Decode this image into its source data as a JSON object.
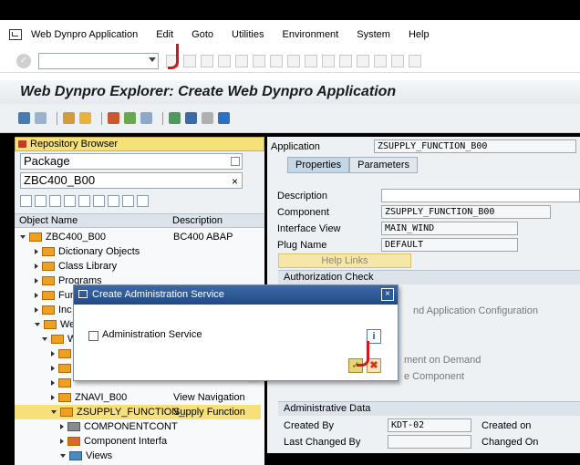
{
  "menubar": {
    "items": [
      {
        "label": "Web Dynpro Application"
      },
      {
        "label": "Edit"
      },
      {
        "label": "Goto"
      },
      {
        "label": "Utilities"
      },
      {
        "label": "Environment"
      },
      {
        "label": "System"
      },
      {
        "label": "Help"
      }
    ]
  },
  "header": {
    "title": "Web Dynpro Explorer: Create Web Dynpro Application"
  },
  "left": {
    "repository_browser": "Repository Browser",
    "object_type": "Package",
    "object_name": "ZBC400_B00",
    "clear_symbol": "×",
    "columns": [
      "Object Name",
      "Description"
    ],
    "tree": [
      {
        "name": "ZBC400_B00",
        "desc": "BC400 ABAP"
      },
      {
        "name": "Dictionary Objects",
        "desc": ""
      },
      {
        "name": "Class Library",
        "desc": ""
      },
      {
        "name": "Programs",
        "desc": ""
      },
      {
        "name": "Fun",
        "desc": ""
      },
      {
        "name": "Inc",
        "desc": ""
      },
      {
        "name": "Web",
        "desc": ""
      },
      {
        "name": "W",
        "desc": ""
      },
      {
        "name": "",
        "desc": ""
      },
      {
        "name": "",
        "desc": ""
      },
      {
        "name": "",
        "desc": ""
      },
      {
        "name": "ZNAVI_B00",
        "desc": "View Navigation"
      },
      {
        "name": "ZSUPPLY_FUNCTION_",
        "desc": "Supply Function"
      },
      {
        "name": "COMPONENTCONT",
        "desc": ""
      },
      {
        "name": "Component Interfa",
        "desc": ""
      },
      {
        "name": "Views",
        "desc": ""
      }
    ]
  },
  "right": {
    "application_label": "Application",
    "application_value": "ZSUPPLY_FUNCTION_B00",
    "tabs": [
      "Properties",
      "Parameters"
    ],
    "description_label": "Description",
    "component_label": "Component",
    "component_value": "ZSUPPLY_FUNCTION_B00",
    "interface_view_label": "Interface View",
    "interface_view_value": "MAIN_WIND",
    "plug_name_label": "Plug Name",
    "plug_name_value": "DEFAULT",
    "help_links": "Help Links",
    "authorization_check": "Authorization Check",
    "hidden_config": "nd Application Configuration",
    "hidden_demand": "ment on Demand",
    "hidden_component": "e Component",
    "admin_data": "Administrative Data",
    "created_by_label": "Created By",
    "created_by_value": "KDT-02",
    "created_on_label": "Created on",
    "last_changed_by_label": "Last Changed By",
    "changed_on_label": "Changed On"
  },
  "dialog": {
    "title": "Create Administration Service",
    "close_symbol": "×",
    "checkbox_label": "Administration Service",
    "info_symbol": "i",
    "ok_symbol": "✓",
    "cancel_symbol": "✖"
  },
  "colors": {
    "title_bar": "#204a85",
    "annotation_red": "#d0181b"
  }
}
